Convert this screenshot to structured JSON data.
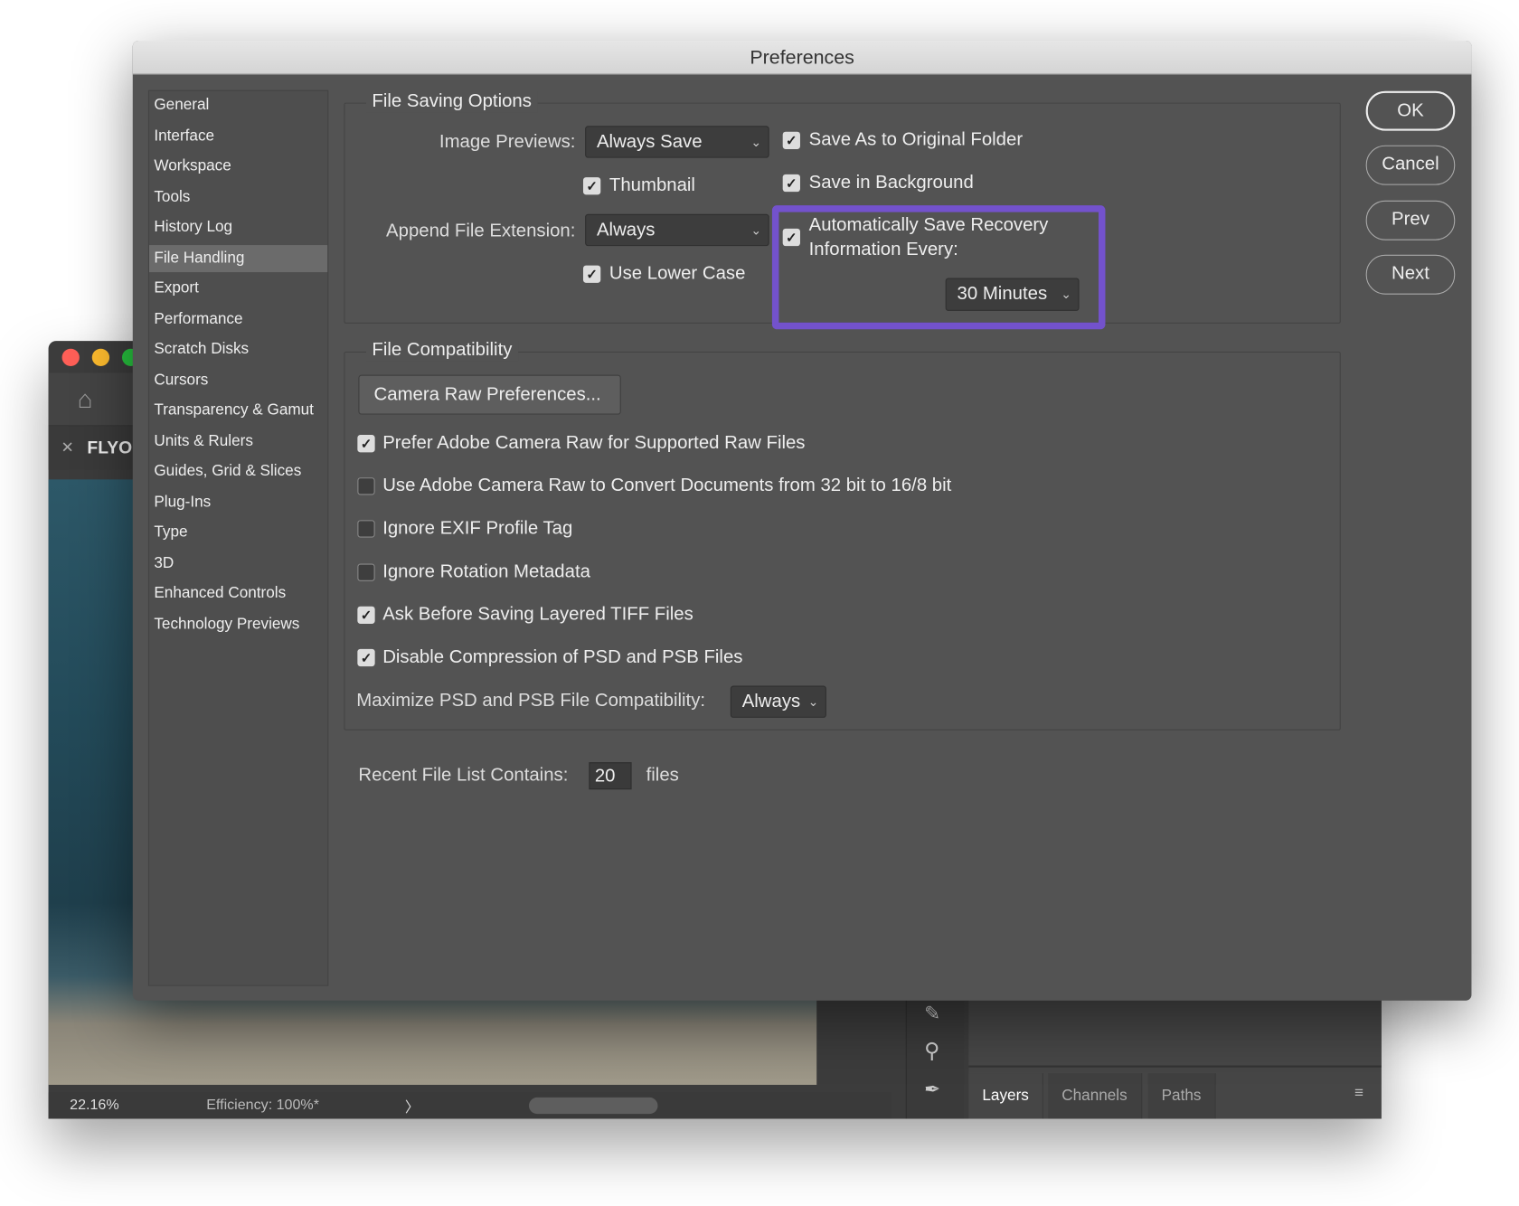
{
  "background_window": {
    "tab_title": "FLYO",
    "zoom": "22.16%",
    "efficiency": "Efficiency: 100%*",
    "panel_tabs": [
      "Layers",
      "Channels",
      "Paths"
    ]
  },
  "dialog": {
    "title": "Preferences",
    "sidebar": [
      "General",
      "Interface",
      "Workspace",
      "Tools",
      "History Log",
      "File Handling",
      "Export",
      "Performance",
      "Scratch Disks",
      "Cursors",
      "Transparency & Gamut",
      "Units & Rulers",
      "Guides, Grid & Slices",
      "Plug-Ins",
      "Type",
      "3D",
      "Enhanced Controls",
      "Technology Previews"
    ],
    "selected": "File Handling",
    "buttons": {
      "ok": "OK",
      "cancel": "Cancel",
      "prev": "Prev",
      "next": "Next"
    },
    "file_saving": {
      "title": "File Saving Options",
      "image_previews_label": "Image Previews:",
      "image_previews_value": "Always Save",
      "thumbnail": {
        "label": "Thumbnail",
        "checked": true
      },
      "append_ext_label": "Append File Extension:",
      "append_ext_value": "Always",
      "lower_case": {
        "label": "Use Lower Case",
        "checked": true
      },
      "save_as_original": {
        "label": "Save As to Original Folder",
        "checked": true
      },
      "save_background": {
        "label": "Save in Background",
        "checked": true
      },
      "auto_save": {
        "line1": "Automatically Save Recovery",
        "line2": "Information Every:",
        "checked": true,
        "interval": "30 Minutes"
      },
      "highlight_color": "#7352cc"
    },
    "file_compat": {
      "title": "File Compatibility",
      "camera_raw_button": "Camera Raw Preferences...",
      "options": [
        {
          "label": "Prefer Adobe Camera Raw for Supported Raw Files",
          "checked": true
        },
        {
          "label": "Use Adobe Camera Raw to Convert Documents from 32 bit to 16/8 bit",
          "checked": false
        },
        {
          "label": "Ignore EXIF Profile Tag",
          "checked": false
        },
        {
          "label": "Ignore Rotation Metadata",
          "checked": false
        },
        {
          "label": "Ask Before Saving Layered TIFF Files",
          "checked": true
        },
        {
          "label": "Disable Compression of PSD and PSB Files",
          "checked": true
        }
      ],
      "maximize_label": "Maximize PSD and PSB File Compatibility:",
      "maximize_value": "Always"
    },
    "recent": {
      "label": "Recent File List Contains:",
      "value": "20",
      "unit": "files"
    }
  }
}
